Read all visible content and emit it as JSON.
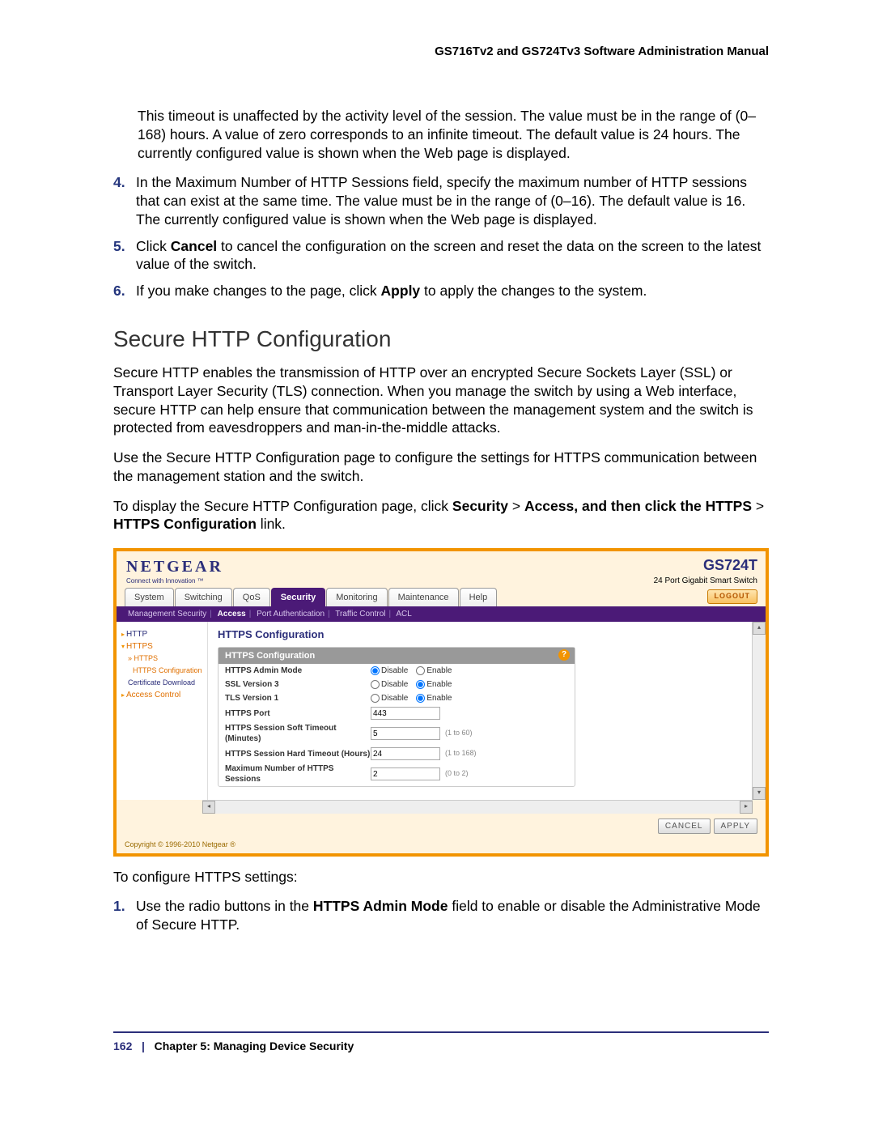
{
  "header": {
    "manual_title": "GS716Tv2 and GS724Tv3 Software Administration Manual"
  },
  "intro": {
    "para1": "This timeout is unaffected by the activity level of the session. The value must be in the range of (0–168) hours. A value of zero corresponds to an infinite timeout. The default value is 24 hours. The currently configured value is shown when the Web page is displayed."
  },
  "steps_a": {
    "n4": "4.",
    "t4": "In the Maximum Number of HTTP Sessions field, specify the maximum number of HTTP sessions that can exist at the same time. The value must be in the range of (0–16). The default value is 16. The currently configured value is shown when the Web page is displayed.",
    "n5": "5.",
    "t5a": "Click ",
    "t5b": "Cancel",
    "t5c": " to cancel the configuration on the screen and reset the data on the screen to the latest value of the switch.",
    "n6": "6.",
    "t6a": "If you make changes to the page, click ",
    "t6b": "Apply",
    "t6c": " to apply the changes to the system."
  },
  "section": {
    "heading": "Secure HTTP Configuration",
    "p1": "Secure HTTP enables the transmission of HTTP over an encrypted Secure Sockets Layer (SSL) or Transport Layer Security (TLS) connection. When you manage the switch by using a Web interface, secure HTTP can help ensure that communication between the management system and the switch is protected from eavesdroppers and man-in-the-middle attacks.",
    "p2": "Use the Secure HTTP Configuration page to configure the settings for HTTPS communication between the management station and the switch.",
    "p3a": "To display the Secure HTTP Configuration page, click ",
    "p3b": "Security",
    "p3c": " > ",
    "p3d": "Access, and then click the HTTPS",
    "p3e": " > ",
    "p3f": "HTTPS Configuration",
    "p3g": " link."
  },
  "ui": {
    "logo": "NETGEAR",
    "logo_sub": "Connect with Innovation ™",
    "model": "GS724T",
    "model_sub": "24 Port Gigabit Smart Switch",
    "logout": "LOGOUT",
    "tabs": [
      "System",
      "Switching",
      "QoS",
      "Security",
      "Monitoring",
      "Maintenance",
      "Help"
    ],
    "subnav": [
      "Management Security",
      "Access",
      "Port Authentication",
      "Traffic Control",
      "ACL"
    ],
    "sidebar": {
      "http": "HTTP",
      "https": "HTTPS",
      "https_sub": "HTTPS Configuration",
      "cert": "Certificate Download",
      "access": "Access Control"
    },
    "content_title": "HTTPS Configuration",
    "panel_title": "HTTPS Configuration",
    "rows": {
      "admin": {
        "label": "HTTPS Admin Mode",
        "disable": "Disable",
        "enable": "Enable"
      },
      "ssl3": {
        "label": "SSL Version 3",
        "disable": "Disable",
        "enable": "Enable"
      },
      "tls1": {
        "label": "TLS Version 1",
        "disable": "Disable",
        "enable": "Enable"
      },
      "port": {
        "label": "HTTPS Port",
        "value": "443"
      },
      "soft": {
        "label": "HTTPS Session Soft Timeout (Minutes)",
        "value": "5",
        "hint": "(1 to 60)"
      },
      "hard": {
        "label": "HTTPS Session Hard Timeout (Hours)",
        "value": "24",
        "hint": "(1 to 168)"
      },
      "max": {
        "label": "Maximum Number of HTTPS Sessions",
        "value": "2",
        "hint": "(0 to 2)"
      }
    },
    "cancel": "CANCEL",
    "apply": "APPLY",
    "copyright": "Copyright © 1996-2010 Netgear ®"
  },
  "after": {
    "p1": "To configure HTTPS settings:",
    "n1": "1.",
    "t1a": "Use the radio buttons in the ",
    "t1b": "HTTPS Admin Mode",
    "t1c": " field to enable or disable the Administrative Mode of Secure HTTP."
  },
  "footer": {
    "page": "162",
    "sep": "|",
    "chapter": "Chapter 5:  Managing Device Security"
  }
}
